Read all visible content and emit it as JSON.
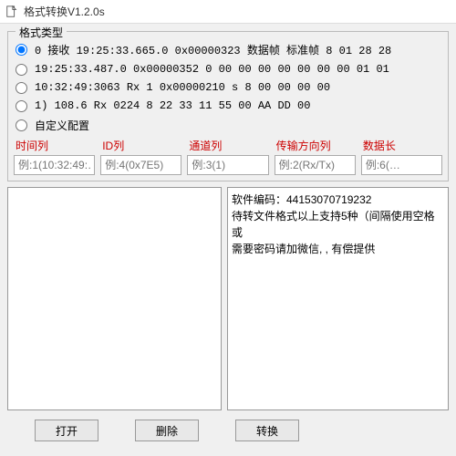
{
  "window": {
    "title": "格式转换V1.2.0s"
  },
  "group": {
    "legend": "格式类型"
  },
  "formats": [
    {
      "text": "0    接收   19:25:33.665.0  0x00000323   数据帧  标准帧  8    01 28 28",
      "selected": true
    },
    {
      "text": "19:25:33.487.0   0x00000352   0 00 00 00 00 00 00 00 01 01",
      "selected": false
    },
    {
      "text": "10:32:49:3063     Rx     1     0x00000210     s    8      00 00 00 00",
      "selected": false
    },
    {
      "text": "1)    108.6       Rx    0224   8   22 33 11 55 00 AA DD 00",
      "selected": false
    },
    {
      "text": "自定义配置",
      "selected": false
    }
  ],
  "columns": [
    {
      "label": "时间列",
      "placeholder": "例:1(10:32:49:…"
    },
    {
      "label": "ID列",
      "placeholder": "例:4(0x7E5)"
    },
    {
      "label": "通道列",
      "placeholder": "例:3(1)"
    },
    {
      "label": "传输方向列",
      "placeholder": "例:2(Rx/Tx)"
    },
    {
      "label": "数据长",
      "placeholder": "例:6(…"
    }
  ],
  "info": {
    "line1": "软件编码：44153070719232",
    "line2": "待转文件格式以上支持5种（间隔使用空格或",
    "line3": "需要密码请加微信,                , 有偿提供"
  },
  "buttons": {
    "open": "打开",
    "delete": "删除",
    "convert": "转换"
  }
}
